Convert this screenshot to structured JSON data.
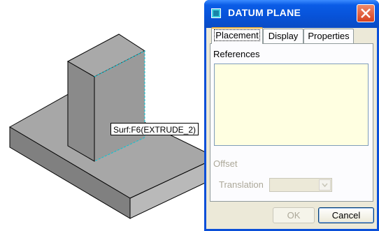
{
  "viewport": {
    "tooltip": "Surf:F6(EXTRUDE_2)"
  },
  "dialog": {
    "title": "DATUM PLANE",
    "tabs": [
      {
        "label": "Placement",
        "active": true
      },
      {
        "label": "Display",
        "active": false
      },
      {
        "label": "Properties",
        "active": false
      }
    ],
    "placement": {
      "references_label": "References",
      "offset_label": "Offset",
      "translation_label": "Translation",
      "translation_value": ""
    },
    "buttons": {
      "ok": "OK",
      "cancel": "Cancel"
    }
  },
  "colors": {
    "title_bar": "#0752d8",
    "references_box": "#ffffe1",
    "highlight_edge": "#00c8d8",
    "model_gray": "#8c8c8c"
  },
  "icons": {
    "title": "datum-plane-icon",
    "close": "close-icon",
    "dropdown": "chevron-down-icon"
  }
}
